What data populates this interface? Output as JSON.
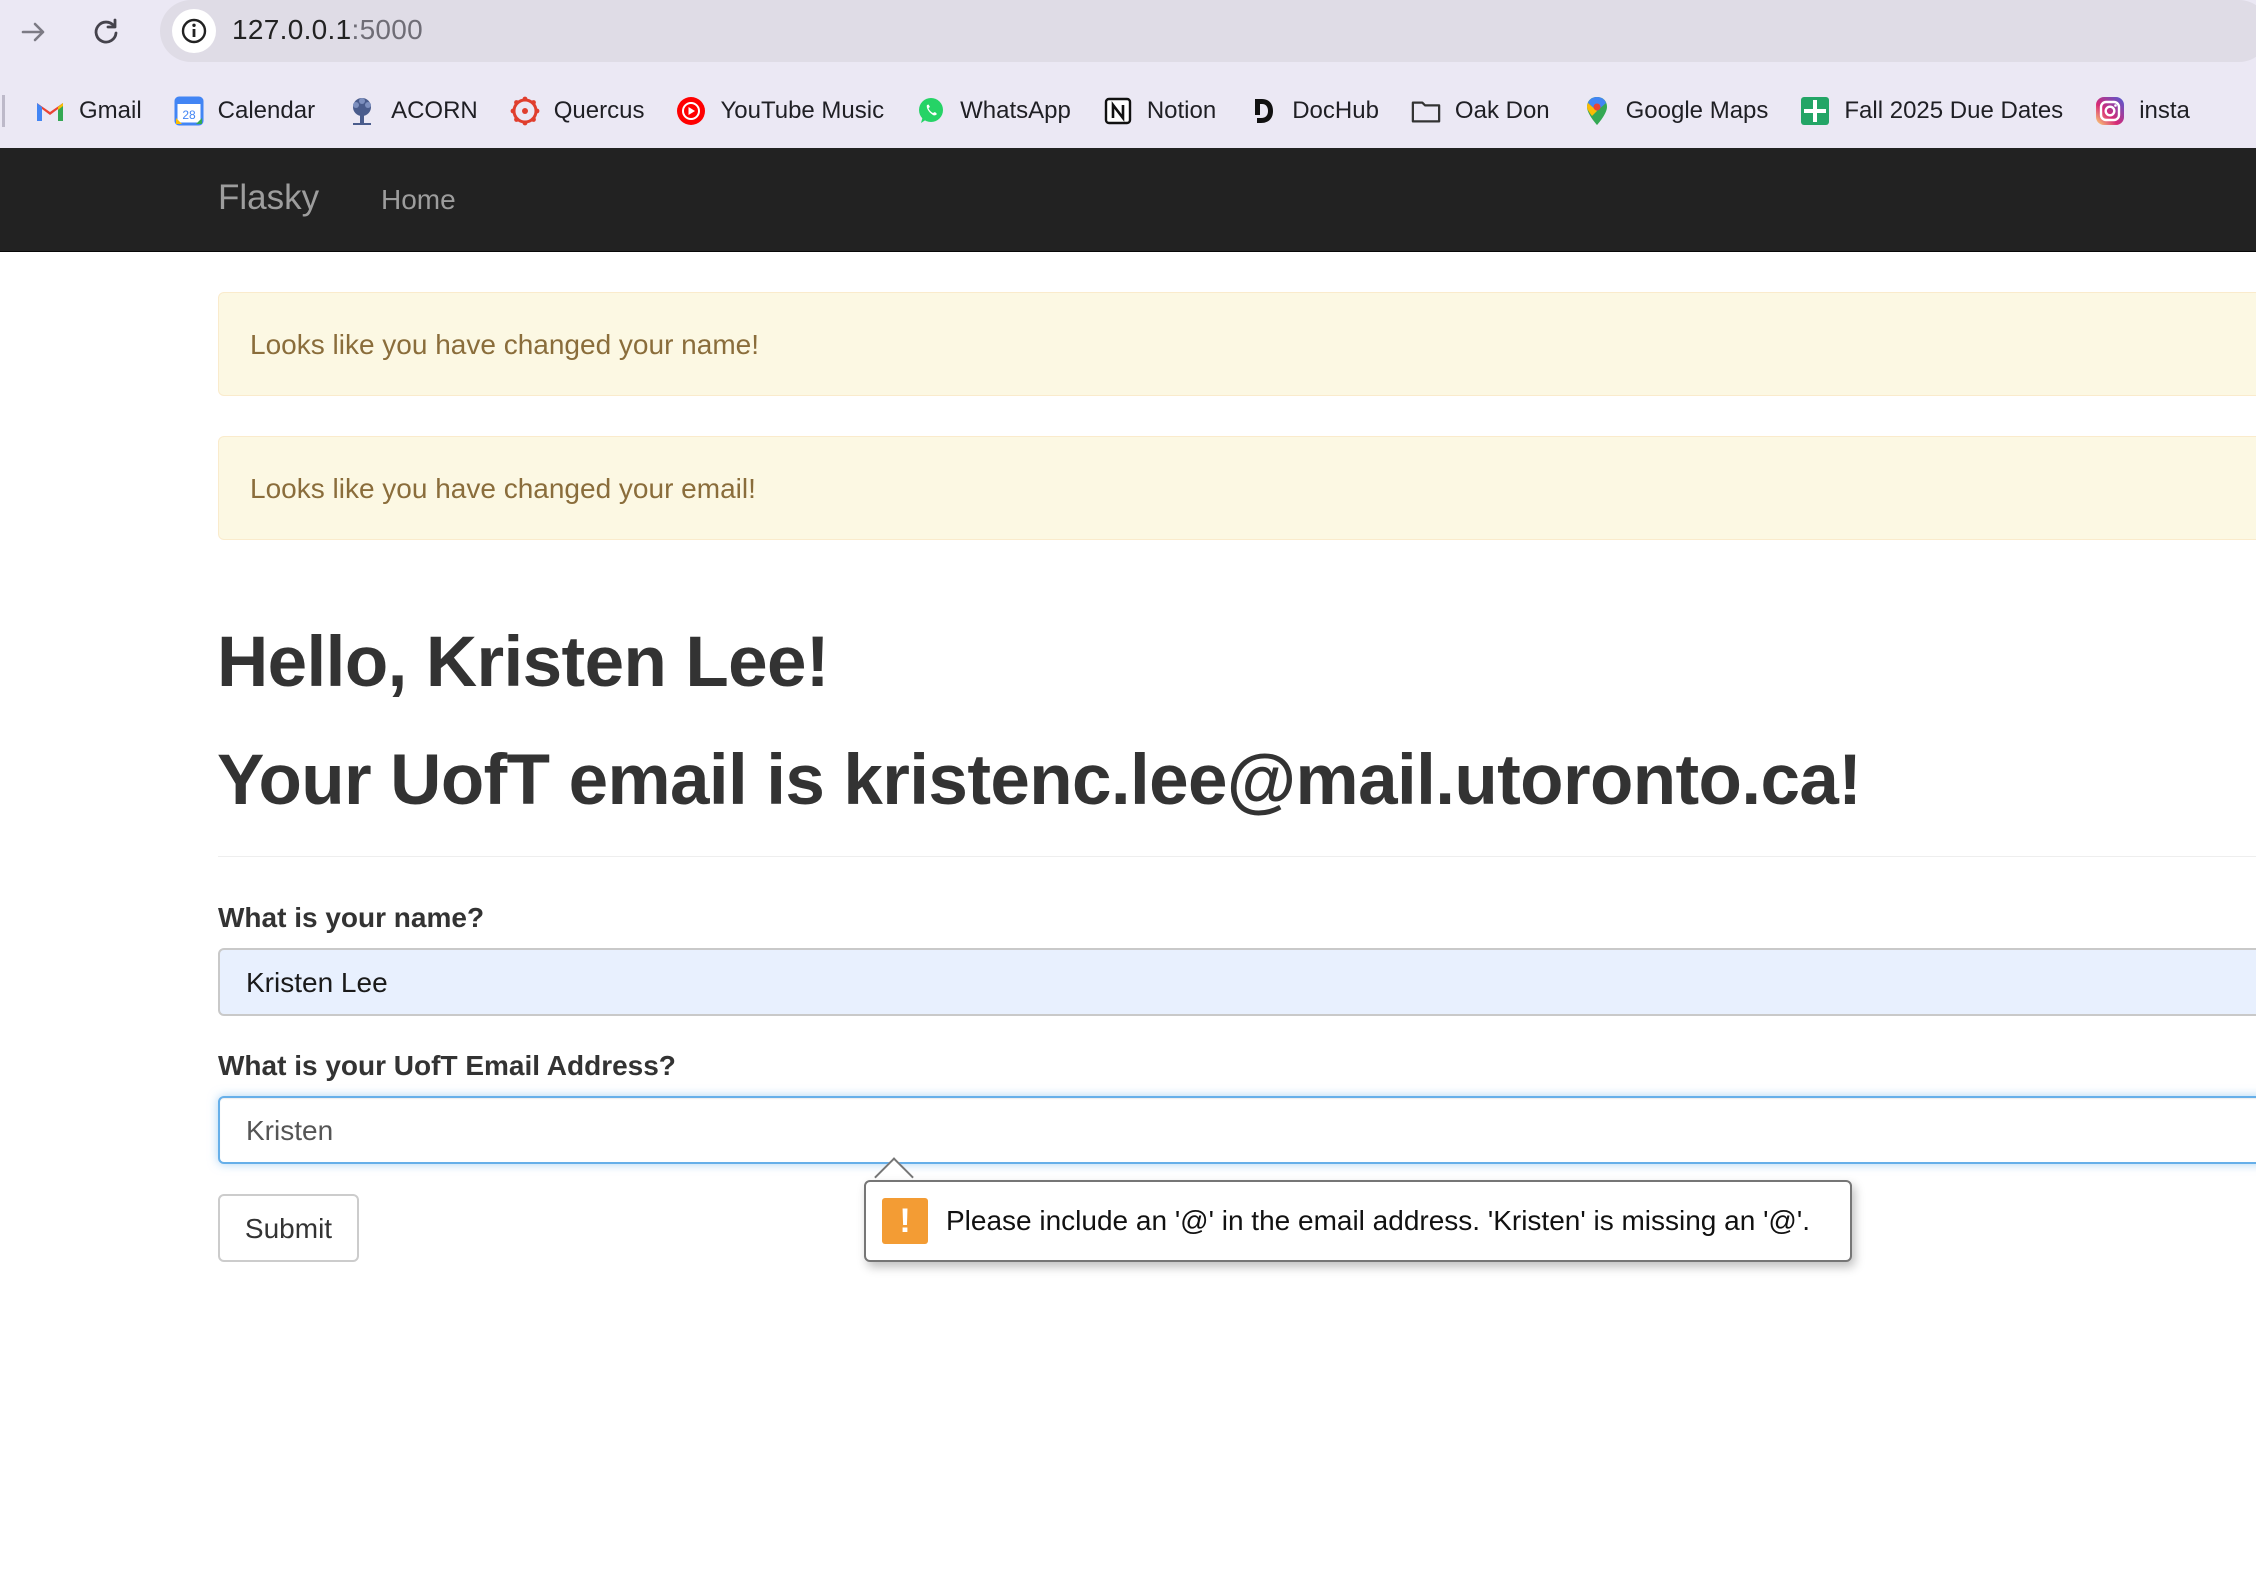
{
  "browser": {
    "url_host": "127.0.0.1",
    "url_port": ":5000",
    "bookmarks": [
      {
        "label": "Gmail",
        "icon": "gmail-icon"
      },
      {
        "label": "Calendar",
        "icon": "calendar-icon"
      },
      {
        "label": "ACORN",
        "icon": "acorn-icon"
      },
      {
        "label": "Quercus",
        "icon": "quercus-icon"
      },
      {
        "label": "YouTube Music",
        "icon": "youtube-music-icon"
      },
      {
        "label": "WhatsApp",
        "icon": "whatsapp-icon"
      },
      {
        "label": "Notion",
        "icon": "notion-icon"
      },
      {
        "label": "DocHub",
        "icon": "dochub-icon"
      },
      {
        "label": "Oak Don",
        "icon": "folder-icon"
      },
      {
        "label": "Google Maps",
        "icon": "google-maps-icon"
      },
      {
        "label": "Fall 2025 Due Dates",
        "icon": "sheets-icon"
      },
      {
        "label": "insta",
        "icon": "instagram-icon"
      }
    ],
    "calendar_icon_text": "28"
  },
  "navbar": {
    "brand": "Flasky",
    "home": "Home"
  },
  "alerts": {
    "name_changed": "Looks like you have changed your name!",
    "email_changed": "Looks like you have changed your email!"
  },
  "page": {
    "greeting": "Hello, Kristen Lee!",
    "email_statement": "Your UofT email is kristenc.lee@mail.utoronto.ca!"
  },
  "form": {
    "name_label": "What is your name?",
    "name_value": "Kristen Lee",
    "email_label": "What is your UofT Email Address?",
    "email_value": "Kristen",
    "submit_label": "Submit"
  },
  "validation": {
    "message": "Please include an '@' in the email address. 'Kristen' is missing an '@'.",
    "icon_glyph": "!"
  },
  "colors": {
    "navbar_bg": "#222222",
    "alert_bg": "#fcf8e3",
    "alert_text": "#8a6d3b",
    "focus_border": "#66afe9",
    "warning_icon": "#f39c34"
  }
}
